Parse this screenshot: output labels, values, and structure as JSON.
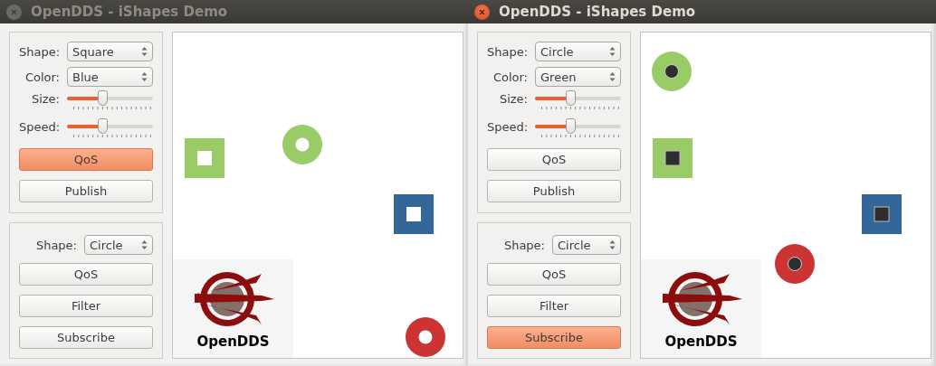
{
  "windows": [
    {
      "title": "OpenDDS - iShapes Demo",
      "active": false,
      "publisher": {
        "fields": [
          {
            "label": "Shape:",
            "value": "Square"
          },
          {
            "label": "Color:",
            "value": "Blue"
          }
        ],
        "sliders": [
          {
            "label": "Size:",
            "level": 0.41
          },
          {
            "label": "Speed:",
            "level": 0.41
          }
        ],
        "buttons": [
          {
            "label": "QoS",
            "focused": true
          },
          {
            "label": "Publish",
            "focused": false
          }
        ]
      },
      "subscriber": {
        "fields": [
          {
            "label": "Shape:",
            "value": "Circle"
          }
        ],
        "buttons": [
          {
            "label": "QoS",
            "focused": false
          },
          {
            "label": "Filter",
            "focused": false
          },
          {
            "label": "Subscribe",
            "focused": false
          }
        ]
      },
      "logo": {
        "text": "OpenDDS"
      },
      "shapes": [
        {
          "kind": "square",
          "color": "#99cc66",
          "dark_center": false
        },
        {
          "kind": "circle",
          "color": "#99cc66",
          "dark_center": false
        },
        {
          "kind": "square",
          "color": "#336699",
          "dark_center": false
        },
        {
          "kind": "circle",
          "color": "#cc3333",
          "dark_center": false
        }
      ]
    },
    {
      "title": "OpenDDS - iShapes Demo",
      "active": true,
      "publisher": {
        "fields": [
          {
            "label": "Shape:",
            "value": "Circle"
          },
          {
            "label": "Color:",
            "value": "Green"
          }
        ],
        "sliders": [
          {
            "label": "Size:",
            "level": 0.41
          },
          {
            "label": "Speed:",
            "level": 0.41
          }
        ],
        "buttons": [
          {
            "label": "QoS",
            "focused": false
          },
          {
            "label": "Publish",
            "focused": false
          }
        ]
      },
      "subscriber": {
        "fields": [
          {
            "label": "Shape:",
            "value": "Circle"
          }
        ],
        "buttons": [
          {
            "label": "QoS",
            "focused": false
          },
          {
            "label": "Filter",
            "focused": false
          },
          {
            "label": "Subscribe",
            "focused": true
          }
        ]
      },
      "logo": {
        "text": "OpenDDS"
      },
      "shapes": [
        {
          "kind": "circle",
          "color": "#99cc66",
          "dark_center": true
        },
        {
          "kind": "square",
          "color": "#99cc66",
          "dark_center": true
        },
        {
          "kind": "square",
          "color": "#336699",
          "dark_center": true
        },
        {
          "kind": "circle",
          "color": "#cc3333",
          "dark_center": true
        }
      ]
    }
  ]
}
